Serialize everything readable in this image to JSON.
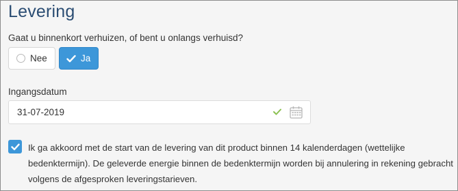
{
  "section": {
    "title": "Levering"
  },
  "moving": {
    "question": "Gaat u binnenkort verhuizen, of bent u onlangs verhuisd?",
    "options": [
      {
        "label": "Nee",
        "selected": false
      },
      {
        "label": "Ja",
        "selected": true
      }
    ]
  },
  "start_date": {
    "label": "Ingangsdatum",
    "value": "31-07-2019",
    "valid": true,
    "valid_icon": "checkmark-icon",
    "picker_icon": "calendar-icon"
  },
  "agreement": {
    "checked": true,
    "line1": "Ik ga akkoord met de start van de levering van dit product binnen 14 kalenderdagen (wettelijke",
    "line2": "bedenktermijn). De geleverde energie binnen de bedenktermijn worden bij annulering in rekening gebracht",
    "line3": "volgens de afgesproken leveringstarieven."
  },
  "colors": {
    "title": "#2b4d73",
    "accent": "#3d97d9",
    "valid": "#8cc152",
    "background": "#f5f5f5"
  }
}
